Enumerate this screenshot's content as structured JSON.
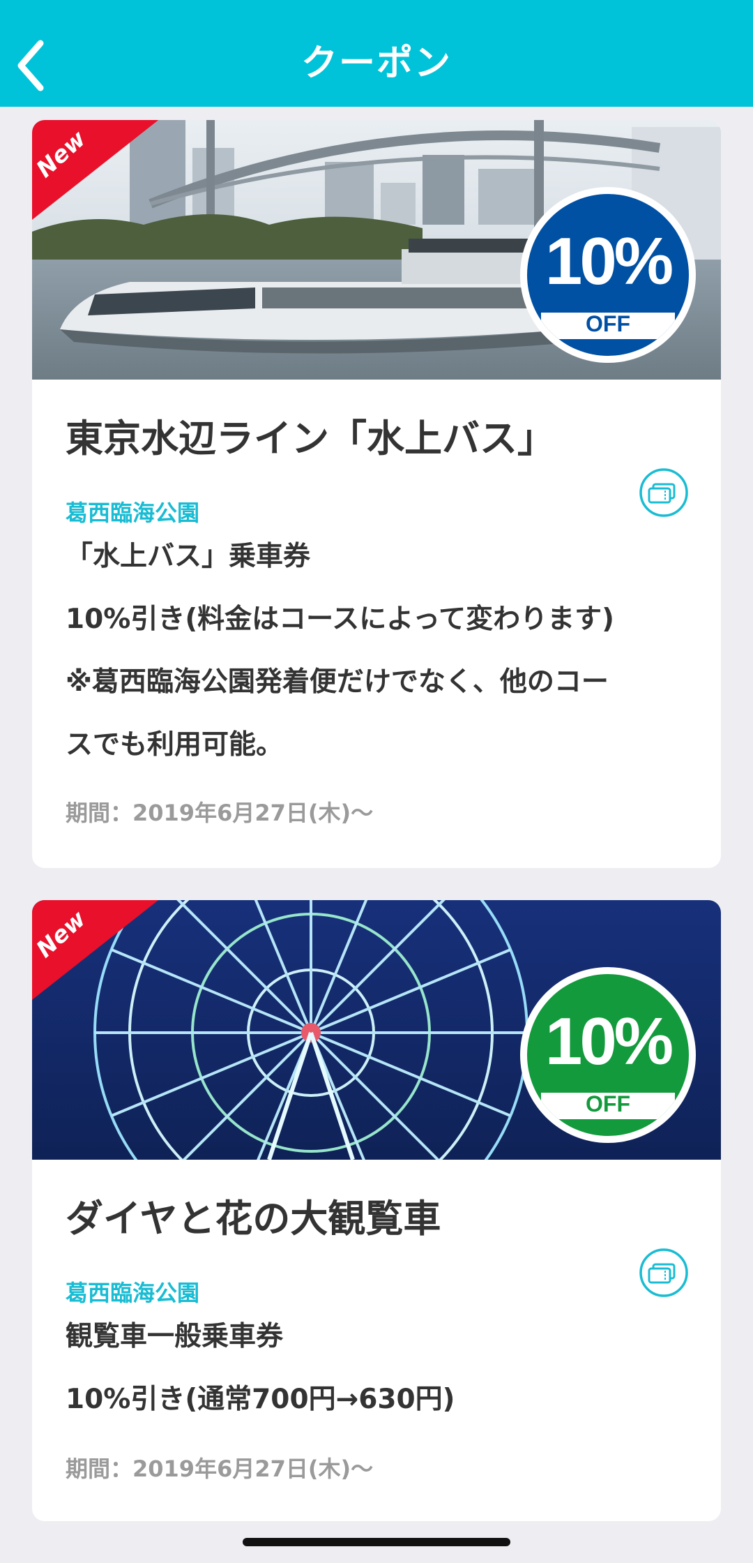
{
  "header": {
    "title": "クーポン",
    "background": "#00c3d9"
  },
  "coupons": [
    {
      "ribbon": "New",
      "badge": {
        "percent": "10%",
        "off": "OFF",
        "color": "#0050a3"
      },
      "title": "東京水辺ライン「水上バス」",
      "place": "葛西臨海公園",
      "lines": [
        "「水上バス」乗車券",
        "10%引き(料金はコースによって変わります)",
        "※葛西臨海公園発着便だけでなく、他のコー",
        "スでも利用可能。"
      ],
      "period": "期間：2019年6月27日(木)〜",
      "image": "water-bus-photo"
    },
    {
      "ribbon": "New",
      "badge": {
        "percent": "10%",
        "off": "OFF",
        "color": "#129a3c"
      },
      "title": "ダイヤと花の大観覧車",
      "place": "葛西臨海公園",
      "lines": [
        "観覧車一般乗車券",
        "10%引き(通常700円→630円)"
      ],
      "period": "期間：2019年6月27日(木)〜",
      "image": "ferris-wheel-photo"
    }
  ],
  "colors": {
    "ribbon": "#e8102a",
    "accent": "#19bcd3",
    "page_bg": "#eeedf2"
  }
}
